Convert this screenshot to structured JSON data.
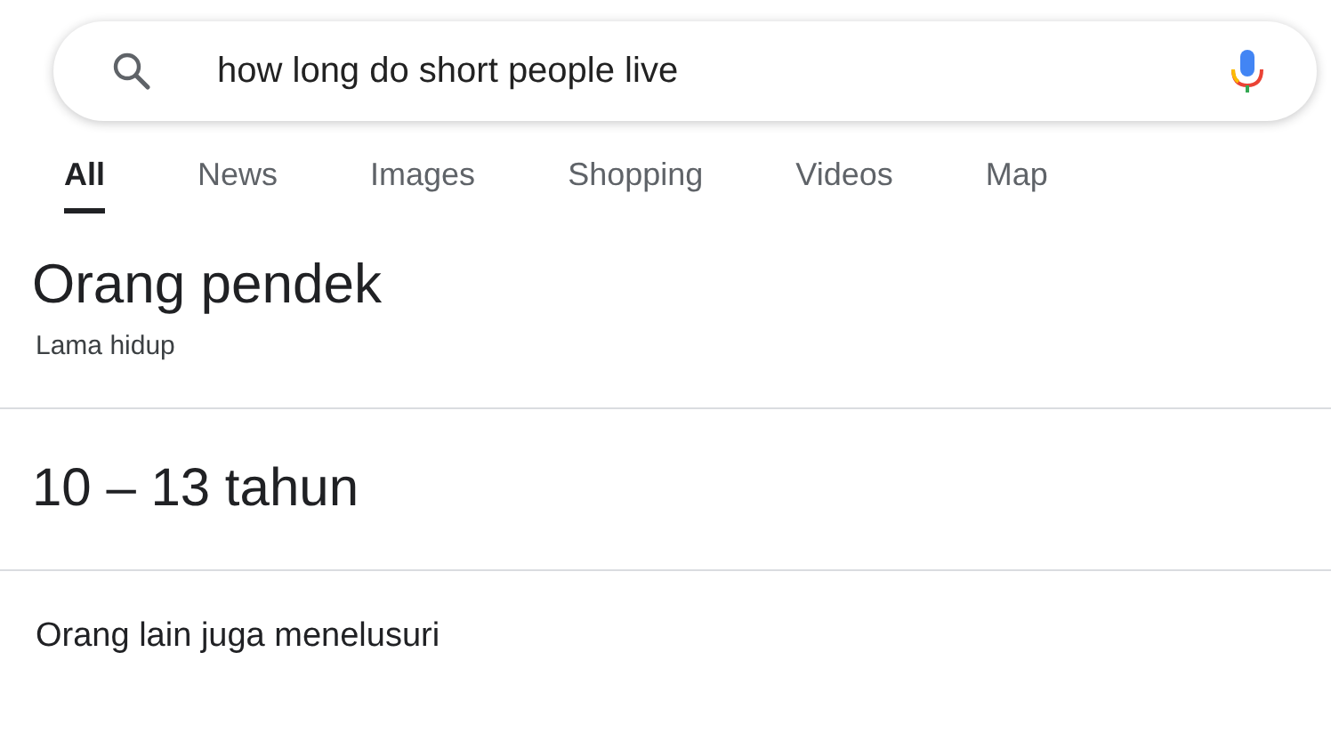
{
  "search": {
    "value": "how long do short people live"
  },
  "tabs": [
    {
      "label": "All",
      "selected": true
    },
    {
      "label": "News",
      "selected": false
    },
    {
      "label": "Images",
      "selected": false
    },
    {
      "label": "Shopping",
      "selected": false
    },
    {
      "label": "Videos",
      "selected": false
    },
    {
      "label": "Map",
      "selected": false
    }
  ],
  "answer": {
    "title": "Orang pendek",
    "subtitle": "Lama hidup",
    "value": "10 – 13 tahun"
  },
  "related": {
    "heading": "Orang lain juga menelusuri"
  }
}
